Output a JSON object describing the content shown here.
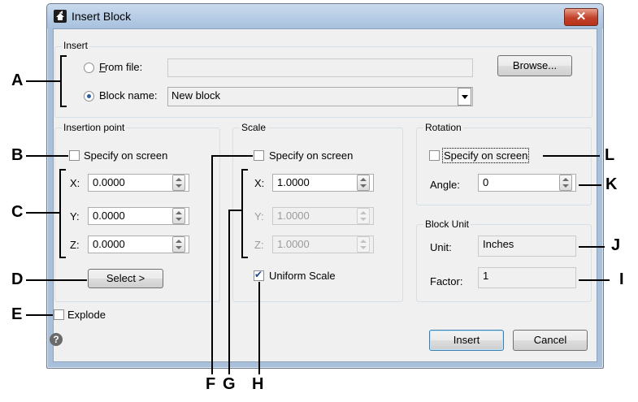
{
  "window": {
    "title": "Insert Block",
    "close_glyph": "✕"
  },
  "insert_group": {
    "label": "Insert",
    "from_file_label": "From file:",
    "from_file_value": "",
    "block_name_label": "Block name:",
    "block_name_value": "New block",
    "browse_label": "Browse..."
  },
  "insertion_point": {
    "label": "Insertion point",
    "specify_label": "Specify on screen",
    "x_label": "X:",
    "x_value": "0.0000",
    "y_label": "Y:",
    "y_value": "0.0000",
    "z_label": "Z:",
    "z_value": "0.0000",
    "select_label": "Select >"
  },
  "scale": {
    "label": "Scale",
    "specify_label": "Specify on screen",
    "x_label": "X:",
    "x_value": "1.0000",
    "y_label": "Y:",
    "y_value": "1.0000",
    "z_label": "Z:",
    "z_value": "1.0000",
    "uniform_label": "Uniform Scale",
    "uniform_checked": true
  },
  "rotation": {
    "label": "Rotation",
    "specify_label": "Specify on screen",
    "angle_label": "Angle:",
    "angle_value": "0"
  },
  "block_unit": {
    "label": "Block Unit",
    "unit_label": "Unit:",
    "unit_value": "Inches",
    "factor_label": "Factor:",
    "factor_value": "1"
  },
  "explode_label": "Explode",
  "help_glyph": "?",
  "footer": {
    "insert_label": "Insert",
    "cancel_label": "Cancel"
  },
  "callouts": {
    "A": "A",
    "B": "B",
    "C": "C",
    "D": "D",
    "E": "E",
    "F": "F",
    "G": "G",
    "H": "H",
    "I": "I",
    "J": "J",
    "K": "K",
    "L": "L"
  }
}
